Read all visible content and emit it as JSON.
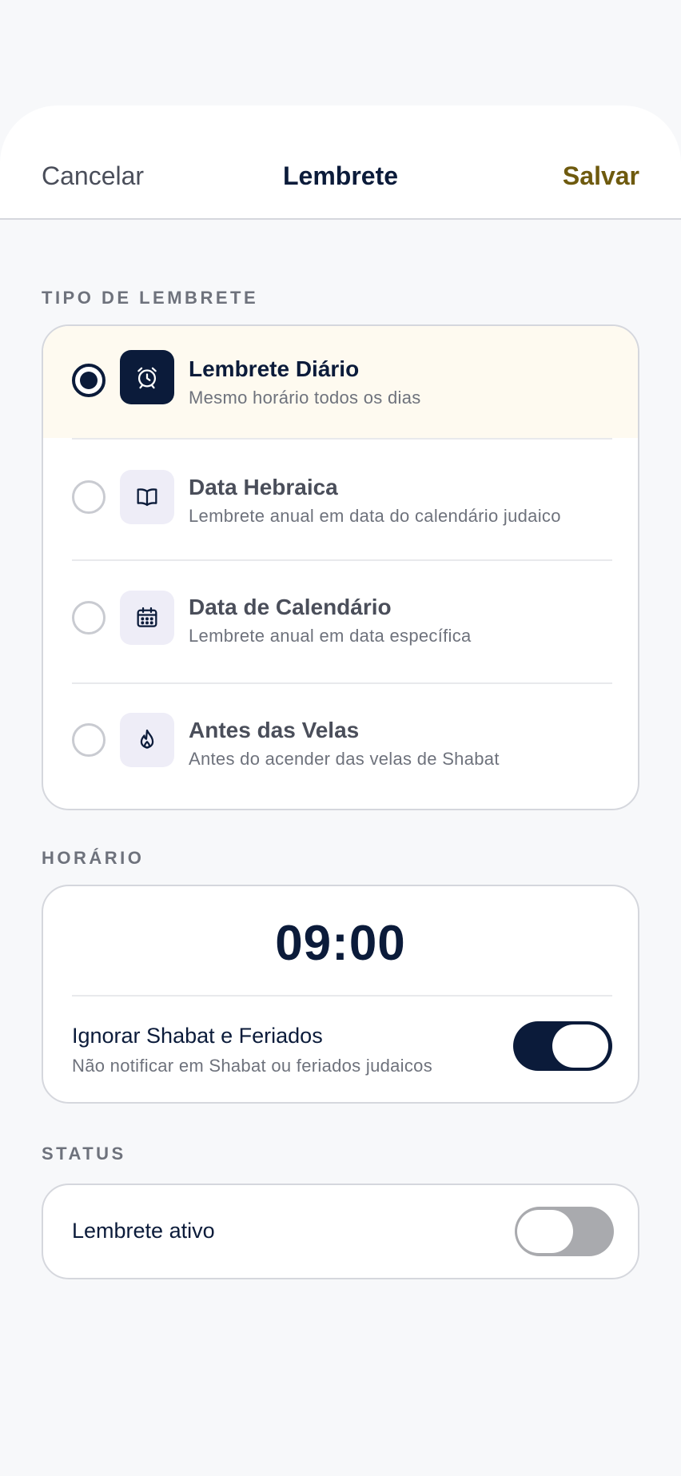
{
  "header": {
    "cancel_label": "Cancelar",
    "title": "Lembrete",
    "save_label": "Salvar"
  },
  "reminder_type": {
    "section_label": "TIPO DE LEMBRETE",
    "options": [
      {
        "title": "Lembrete Diário",
        "subtitle": "Mesmo horário todos os dias",
        "icon": "alarm-clock-icon",
        "selected": true
      },
      {
        "title": "Data Hebraica",
        "subtitle": "Lembrete anual em data do calendário judaico",
        "icon": "open-book-icon",
        "selected": false
      },
      {
        "title": "Data de Calendário",
        "subtitle": "Lembrete anual em data específica",
        "icon": "calendar-icon",
        "selected": false
      },
      {
        "title": "Antes das Velas",
        "subtitle": "Antes do acender das velas de Shabat",
        "icon": "flame-icon",
        "selected": false
      }
    ]
  },
  "schedule": {
    "section_label": "HORÁRIO",
    "time": "09:00",
    "skip_shabbat": {
      "title": "Ignorar Shabat e Feriados",
      "subtitle": "Não notificar em Shabat ou feriados judaicos",
      "enabled": true
    }
  },
  "status": {
    "section_label": "STATUS",
    "active": {
      "title": "Lembrete ativo",
      "enabled": false
    }
  },
  "colors": {
    "primary": "#0B1B3A",
    "accent_save": "#6E5A0E",
    "selected_row": "#FEFAF0",
    "background": "#F7F8FA"
  }
}
